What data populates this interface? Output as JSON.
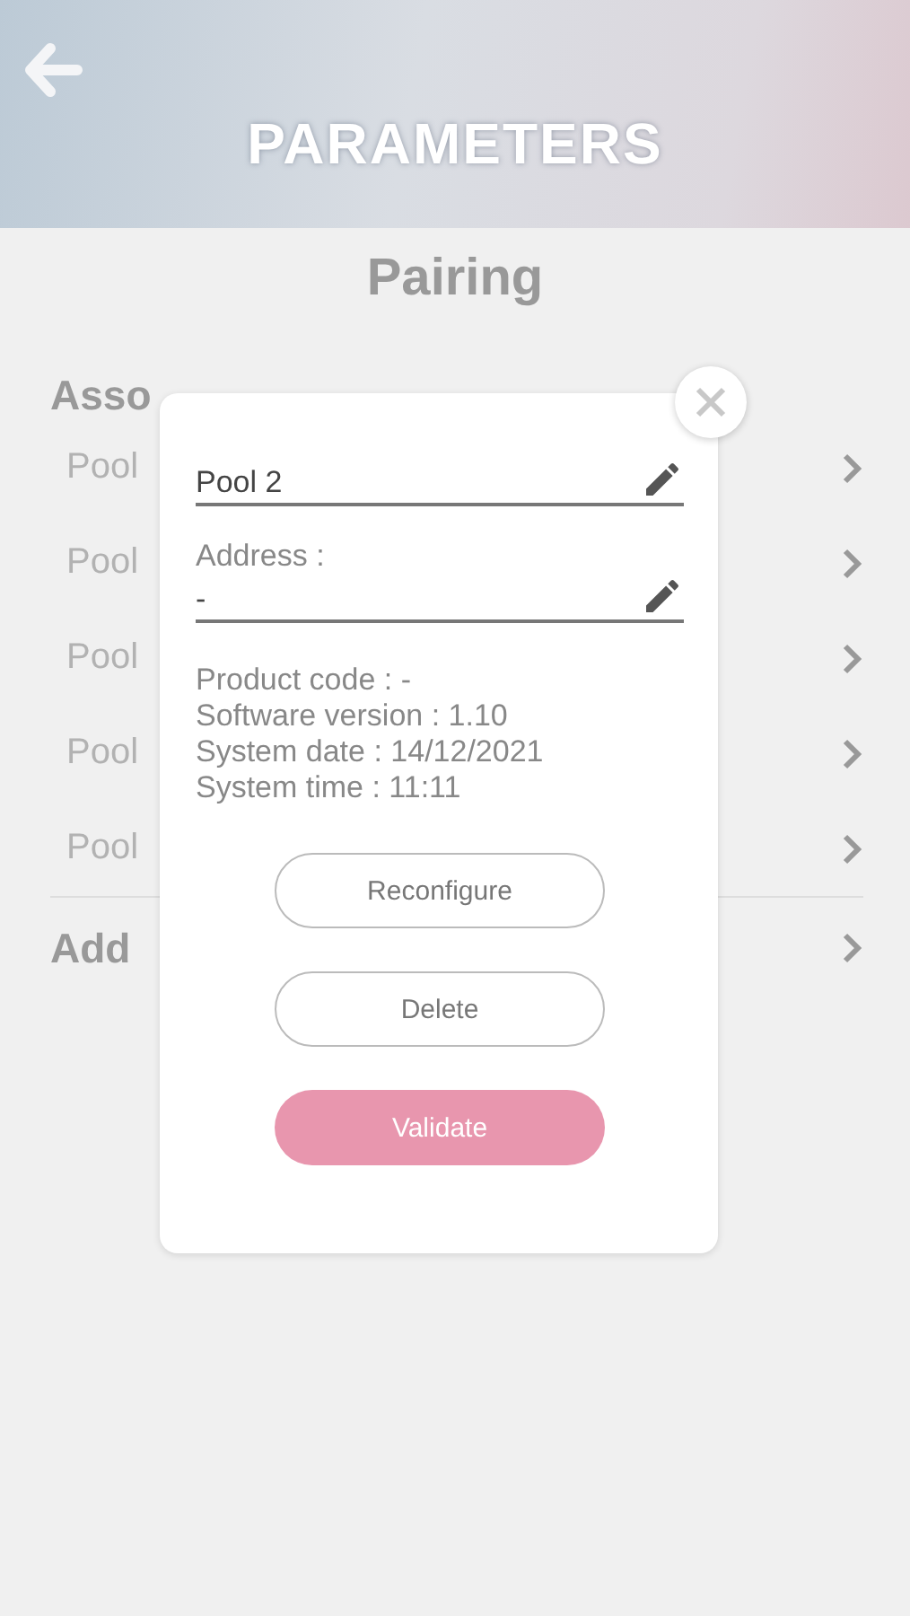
{
  "header": {
    "title": "PARAMETERS"
  },
  "page_title": "Pairing",
  "section_title": "Asso",
  "devices": [
    {
      "label": "Pool"
    },
    {
      "label": "Pool"
    },
    {
      "label": "Pool"
    },
    {
      "label": "Pool"
    },
    {
      "label": "Pool"
    }
  ],
  "add_item": {
    "label": "Add"
  },
  "dialog": {
    "name_field": {
      "value": "Pool 2"
    },
    "address_label": "Address :",
    "address_field": {
      "value": "-"
    },
    "info_lines": [
      "Product code : -",
      "Software version : 1.10",
      "System date : 14/12/2021",
      "System time : 11:11"
    ],
    "buttons": [
      {
        "label": "Reconfigure",
        "kind": "outline"
      },
      {
        "label": "Delete",
        "kind": "outline"
      },
      {
        "label": "Validate",
        "kind": "primary"
      }
    ]
  }
}
